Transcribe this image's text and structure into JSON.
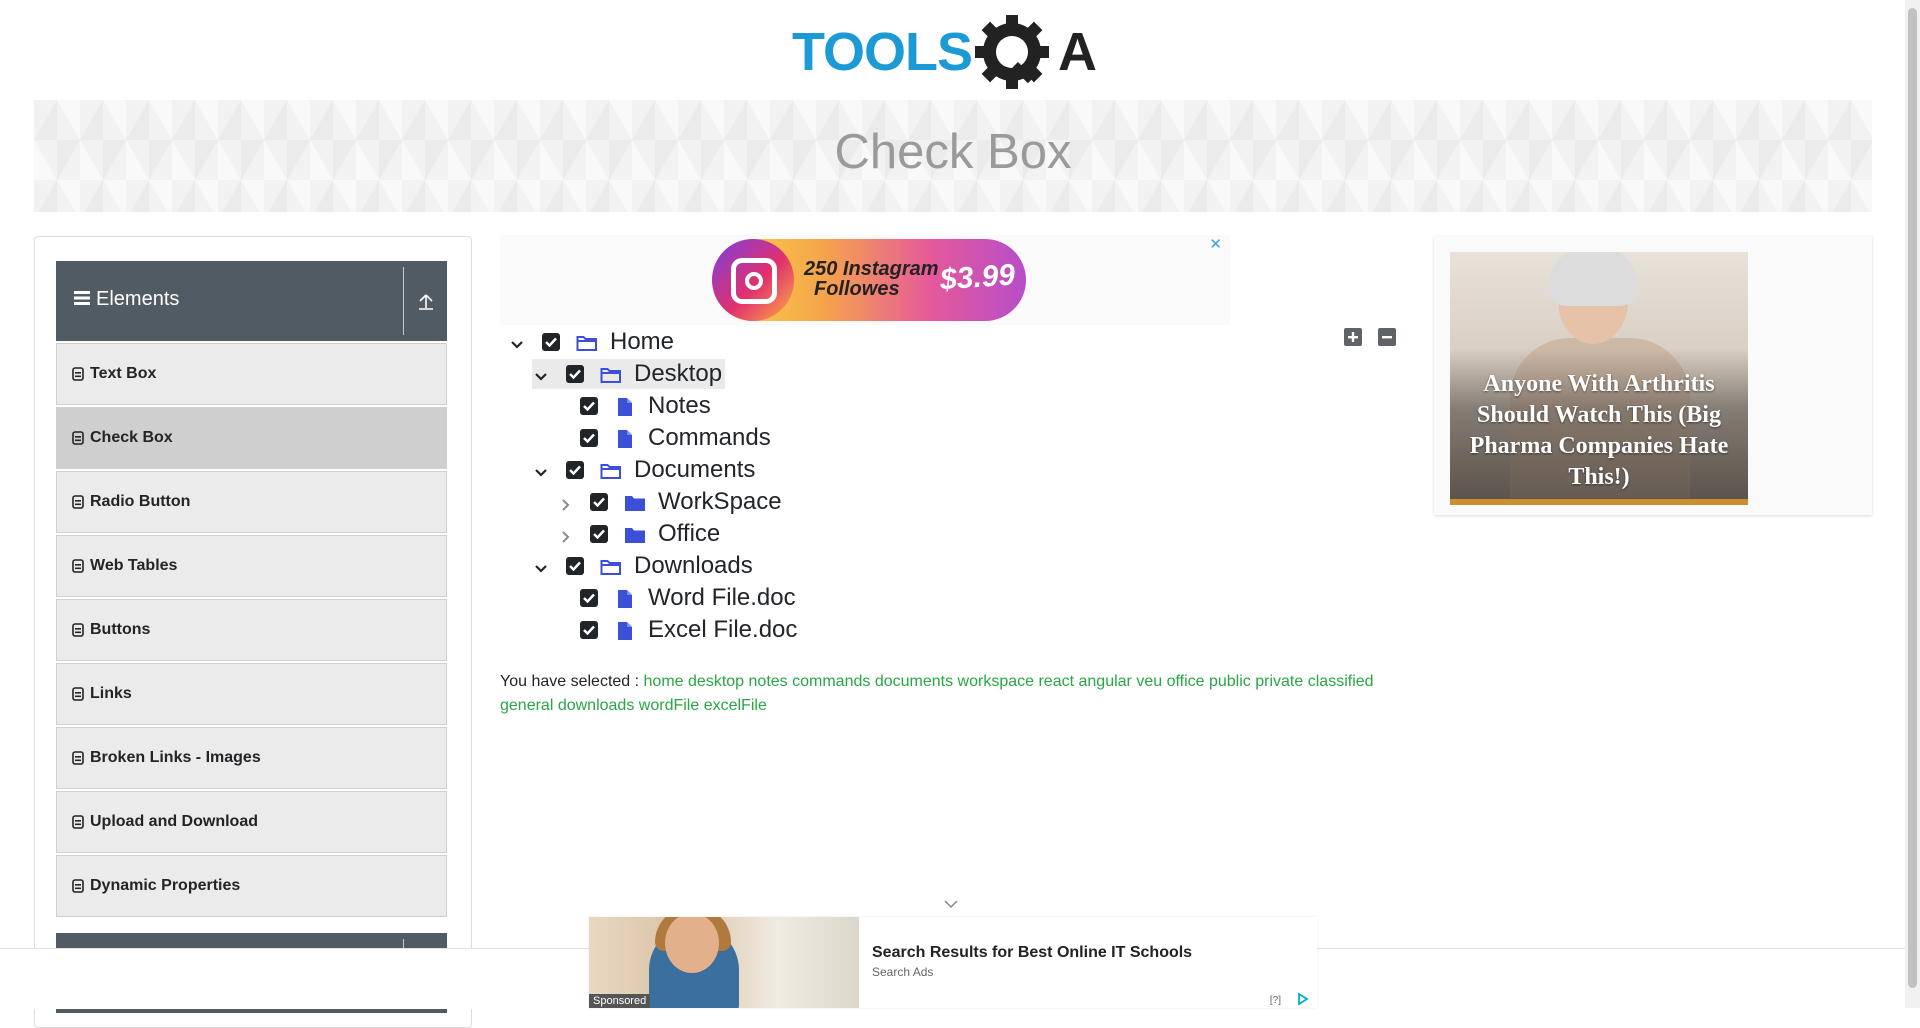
{
  "logo": {
    "text": "TOOLS",
    "text2": "A",
    "icon": "gear-q-icon"
  },
  "page_title": "Check Box",
  "sidebar": {
    "group_title": "Elements",
    "group_icon": "hamburger-icon",
    "collapse_icon": "upload-arrow-icon",
    "items": [
      {
        "label": "Text Box"
      },
      {
        "label": "Check Box",
        "active": true
      },
      {
        "label": "Radio Button"
      },
      {
        "label": "Web Tables"
      },
      {
        "label": "Buttons"
      },
      {
        "label": "Links"
      },
      {
        "label": "Broken Links - Images"
      },
      {
        "label": "Upload and Download"
      },
      {
        "label": "Dynamic Properties"
      }
    ]
  },
  "ad_top": {
    "line1": "250 Instagram",
    "line2": "Followes",
    "price": "$3.99",
    "close": "✕"
  },
  "tree": {
    "expand_all_icon": "plus-square-icon",
    "collapse_all_icon": "minus-square-icon",
    "nodes": [
      {
        "label": "Home",
        "type": "folder-open",
        "expanded": true,
        "checked": true
      },
      {
        "label": "Desktop",
        "type": "folder-open",
        "expanded": true,
        "checked": true
      },
      {
        "label": "Notes",
        "type": "file",
        "checked": true
      },
      {
        "label": "Commands",
        "type": "file",
        "checked": true
      },
      {
        "label": "Documents",
        "type": "folder-open",
        "expanded": true,
        "checked": true
      },
      {
        "label": "WorkSpace",
        "type": "folder-closed",
        "expanded": false,
        "checked": true
      },
      {
        "label": "Office",
        "type": "folder-closed",
        "expanded": false,
        "checked": true
      },
      {
        "label": "Downloads",
        "type": "folder-open",
        "expanded": true,
        "checked": true
      },
      {
        "label": "Word File.doc",
        "type": "file",
        "checked": true
      },
      {
        "label": "Excel File.doc",
        "type": "file",
        "checked": true
      }
    ]
  },
  "result": {
    "prefix": "You have selected :",
    "selected": [
      "home",
      "desktop",
      "notes",
      "commands",
      "documents",
      "workspace",
      "react",
      "angular",
      "veu",
      "office",
      "public",
      "private",
      "classified",
      "general",
      "downloads",
      "wordFile",
      "excelFile"
    ]
  },
  "ad_right": {
    "caption": "Anyone With Arthritis Should Watch This (Big Pharma Companies Hate This!)"
  },
  "ad_bottom": {
    "title": "Search Results for Best Online IT Schools",
    "source": "Search Ads",
    "sponsored": "Sponsored",
    "adchoices_q": "[?]"
  },
  "colors": {
    "accent_green": "#28a745",
    "sidebar_header": "#515b63",
    "logo_blue": "#1b9ad6",
    "tree_icon": "#3d4fd4"
  }
}
